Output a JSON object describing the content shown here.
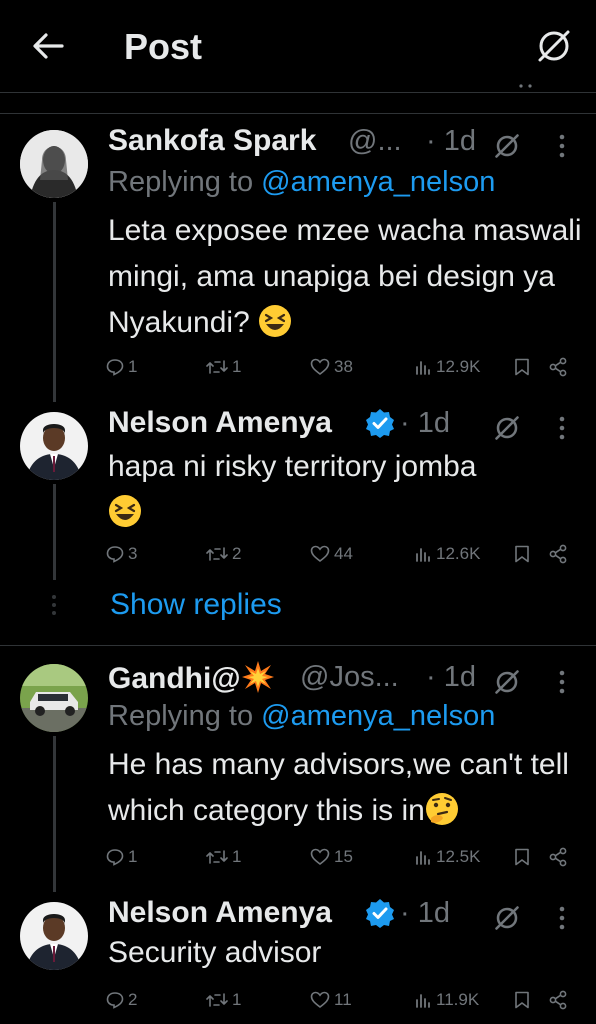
{
  "header": {
    "title": "Post"
  },
  "tweets": [
    {
      "name": "Sankofa Spark",
      "handle": "@...",
      "time": "· 1d",
      "reply_prefix": "Replying to ",
      "reply_handle": "@amenya_nelson",
      "text": "Leta exposee mzee wacha maswali mingi, ama unapiga bei design ya Nyakundi?",
      "stats": {
        "replies": "1",
        "reposts": "1",
        "likes": "38",
        "views": "12.9K"
      }
    },
    {
      "name": "Nelson Amenya",
      "time": "· 1d",
      "text": "hapa ni risky territory jomba",
      "stats": {
        "replies": "3",
        "reposts": "2",
        "likes": "44",
        "views": "12.6K"
      }
    },
    {
      "name": "Gandhi@",
      "handle": "@Jos...",
      "time": "· 1d",
      "reply_prefix": "Replying to ",
      "reply_handle": "@amenya_nelson",
      "text": "He has many advisors,we can't tell which category this is in",
      "stats": {
        "replies": "1",
        "reposts": "1",
        "likes": "15",
        "views": "12.5K"
      }
    },
    {
      "name": "Nelson Amenya",
      "time": "· 1d",
      "text": "Security advisor",
      "stats": {
        "replies": "2",
        "reposts": "1",
        "likes": "11",
        "views": "11.9K"
      }
    }
  ],
  "show_replies": "Show replies",
  "colors": {
    "background": "#000000",
    "link": "#1d9bf0",
    "muted": "#71767b",
    "verified": "#1d9bf0"
  }
}
